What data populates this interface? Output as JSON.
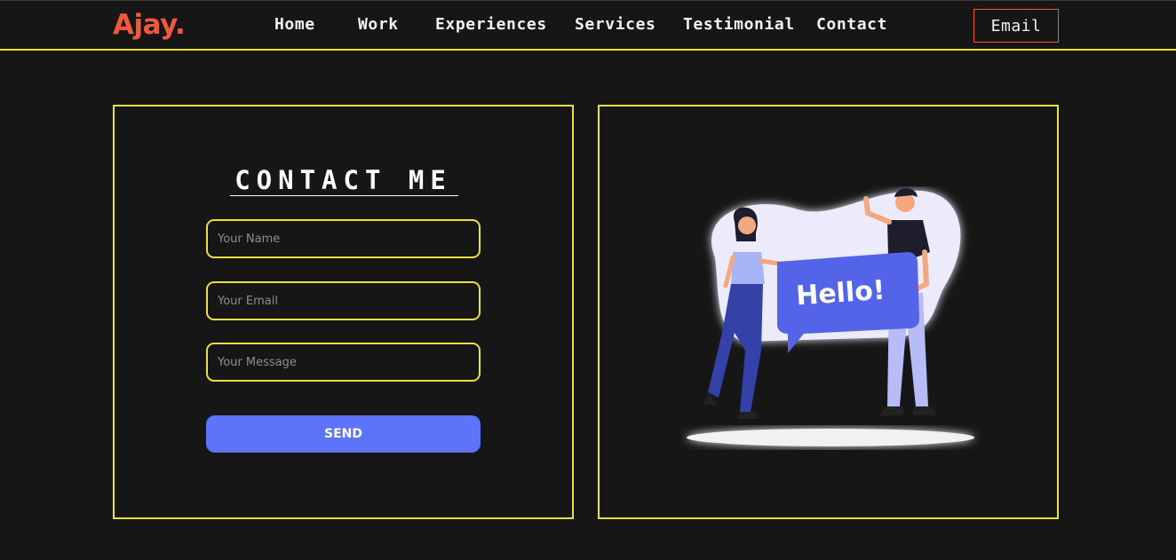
{
  "header": {
    "logo": "Ajay.",
    "nav": [
      {
        "label": "Home"
      },
      {
        "label": "Work"
      },
      {
        "label": "Experiences"
      },
      {
        "label": "Services"
      },
      {
        "label": "Testimonial"
      },
      {
        "label": "Contact"
      }
    ],
    "email_button": "Email"
  },
  "contact": {
    "title": "CONTACT ME",
    "name_placeholder": "Your Name",
    "email_placeholder": "Your Email",
    "message_placeholder": "Your Message",
    "send_label": "SEND"
  },
  "illustration": {
    "sign_text": "Hello!",
    "icon": "hello-illustration"
  },
  "colors": {
    "background": "#161616",
    "accent_yellow": "#e8e23a",
    "brand_orange": "#f05a3a",
    "button_blue": "#5c73fa"
  }
}
